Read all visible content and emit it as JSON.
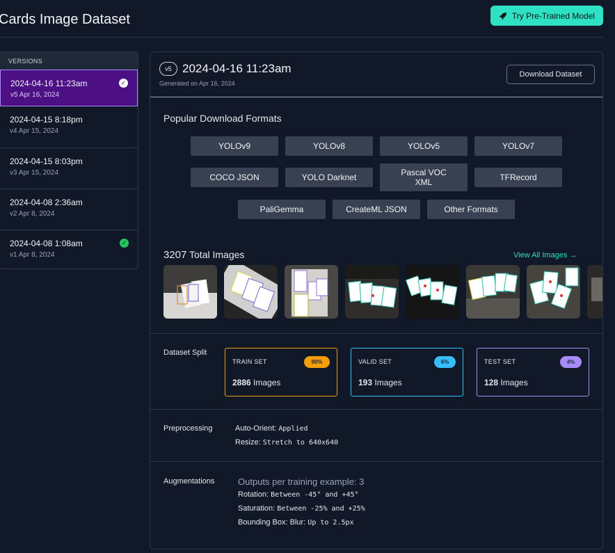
{
  "header": {
    "title": "Cards Image Dataset",
    "try_button": "Try Pre-Trained Model"
  },
  "sidebar": {
    "heading": "VERSIONS",
    "versions": [
      {
        "date": "2024-04-16 11:23am",
        "sub": "v5 Apr 16, 2024",
        "active": true,
        "check": "white"
      },
      {
        "date": "2024-04-15 8:18pm",
        "sub": "v4 Apr 15, 2024",
        "active": false,
        "check": null
      },
      {
        "date": "2024-04-15 8:03pm",
        "sub": "v3 Apr 15, 2024",
        "active": false,
        "check": null
      },
      {
        "date": "2024-04-08 2:36am",
        "sub": "v2 Apr 8, 2024",
        "active": false,
        "check": null
      },
      {
        "date": "2024-04-08 1:08am",
        "sub": "v1 Apr 8, 2024",
        "active": false,
        "check": "green"
      }
    ]
  },
  "version": {
    "badge": "v5",
    "title": "2024-04-16 11:23am",
    "generated": "Generated on Apr 16, 2024",
    "download_button": "Download Dataset"
  },
  "formats": {
    "title": "Popular Download Formats",
    "items": [
      "YOLOv9",
      "YOLOv8",
      "YOLOv5",
      "YOLOv7",
      "COCO JSON",
      "YOLO Darknet",
      "Pascal VOC XML",
      "TFRecord",
      "PaliGemma",
      "CreateML JSON",
      "Other Formats"
    ]
  },
  "images": {
    "count": "3207",
    "label": "Total Images",
    "view_all": "View All Images →"
  },
  "split": {
    "label": "Dataset Split",
    "sets": [
      {
        "name": "TRAIN SET",
        "pct": "90%",
        "count": "2886",
        "unit": "Images",
        "color": "#f59e0b"
      },
      {
        "name": "VALID SET",
        "pct": "6%",
        "count": "193",
        "unit": "Images",
        "color": "#38bdf8"
      },
      {
        "name": "TEST SET",
        "pct": "4%",
        "count": "128",
        "unit": "Images",
        "color": "#a78bfa"
      }
    ]
  },
  "preprocessing": {
    "label": "Preprocessing",
    "auto_orient_key": "Auto-Orient:",
    "auto_orient_val": "Applied",
    "resize_key": "Resize:",
    "resize_val": "Stretch to 640x640"
  },
  "augmentations": {
    "label": "Augmentations",
    "outputs": "Outputs per training example: 3",
    "rotation_key": "Rotation:",
    "rotation_val": "Between -45° and +45°",
    "saturation_key": "Saturation:",
    "saturation_val": "Between -25% and +25%",
    "bbox_key": "Bounding Box: Blur:",
    "bbox_val": "Up to 2.5px"
  }
}
